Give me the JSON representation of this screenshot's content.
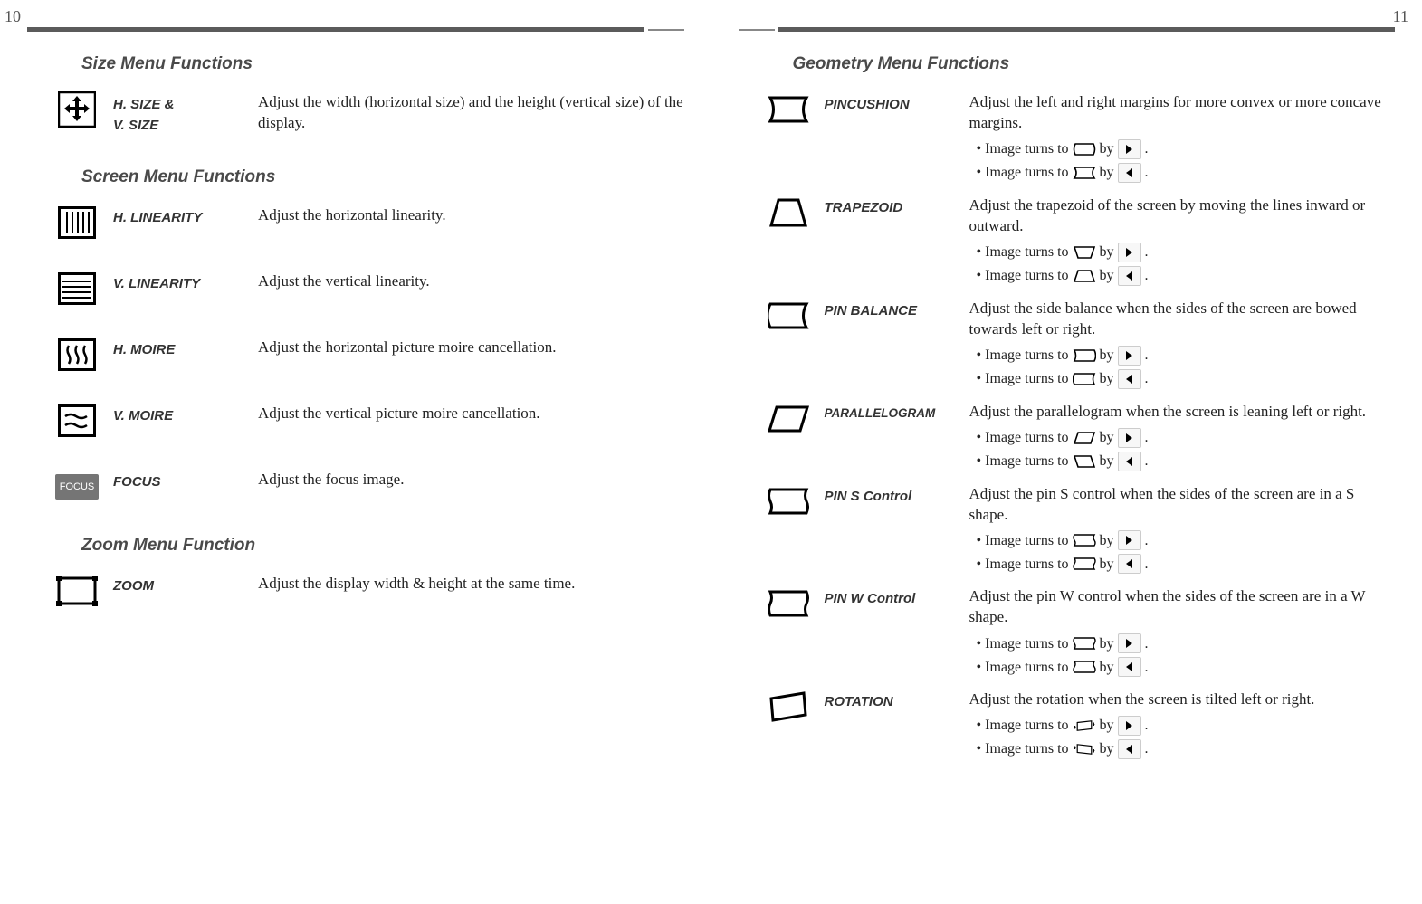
{
  "pagenum_left": "10",
  "pagenum_right": "11",
  "left": {
    "size_section": "Size Menu Functions",
    "screen_section": "Screen Menu Functions",
    "zoom_section": "Zoom Menu Function",
    "items": {
      "hv_size": {
        "label": "H. SIZE &\nV. SIZE",
        "desc": "Adjust the width (horizontal size) and the height (vertical size) of the display."
      },
      "hlin": {
        "label": "H. LINEARITY",
        "desc": "Adjust the horizontal linearity."
      },
      "vlin": {
        "label": "V. LINEARITY",
        "desc": "Adjust the vertical linearity."
      },
      "hmoire": {
        "label": "H. MOIRE",
        "desc": "Adjust the horizontal picture moire cancellation."
      },
      "vmoire": {
        "label": "V. MOIRE",
        "desc": "Adjust the vertical picture moire cancellation."
      },
      "focus": {
        "label": "FOCUS",
        "desc": "Adjust the focus image."
      },
      "zoom": {
        "label": "ZOOM",
        "desc": "Adjust the display width & height at the same time."
      }
    }
  },
  "right": {
    "geo_section": "Geometry Menu Functions",
    "bullet_prefix": "Image turns to",
    "bullet_by": "by",
    "items": {
      "pincushion": {
        "label": "PINCUSHION",
        "desc": "Adjust the left and right margins for more convex or more concave margins."
      },
      "trapezoid": {
        "label": "TRAPEZOID",
        "desc": "Adjust the trapezoid of the screen by moving the lines inward or outward."
      },
      "pinbalance": {
        "label": "PIN BALANCE",
        "desc": "Adjust the side balance when the sides of the screen are bowed towards left or right."
      },
      "parallelogram": {
        "label": "PARALLELOGRAM",
        "desc": "Adjust the parallelogram when the screen is leaning left or right."
      },
      "pins": {
        "label": "PIN S Control",
        "desc": "Adjust the pin S control when the sides of the screen are in a S shape."
      },
      "pinw": {
        "label": "PIN W Control",
        "desc": "Adjust the pin W control when the sides of the screen are in a W shape."
      },
      "rotation": {
        "label": "ROTATION",
        "desc": "Adjust the rotation when the screen is tilted left or right."
      }
    }
  },
  "focus_icon_text": "FOCUS"
}
